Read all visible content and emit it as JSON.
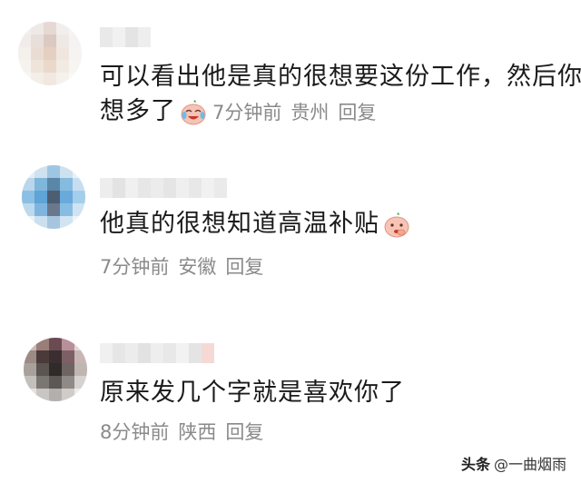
{
  "comments": [
    {
      "line1": "可以看出他是真的很想要这份工作，然后你",
      "line2": "想多了",
      "emoji": "laugh-cry-emoji",
      "time": "7分钟前",
      "location": "贵州",
      "reply_label": "回复"
    },
    {
      "line1": "他真的很想知道高温补贴",
      "emoji": "thinking-emoji",
      "time": "7分钟前",
      "location": "安徽",
      "reply_label": "回复"
    },
    {
      "line1": "原来发几个字就是喜欢你了",
      "time": "8分钟前",
      "location": "陕西",
      "reply_label": "回复"
    }
  ],
  "watermark": {
    "brand": "头条",
    "handle": "@一曲烟雨"
  }
}
